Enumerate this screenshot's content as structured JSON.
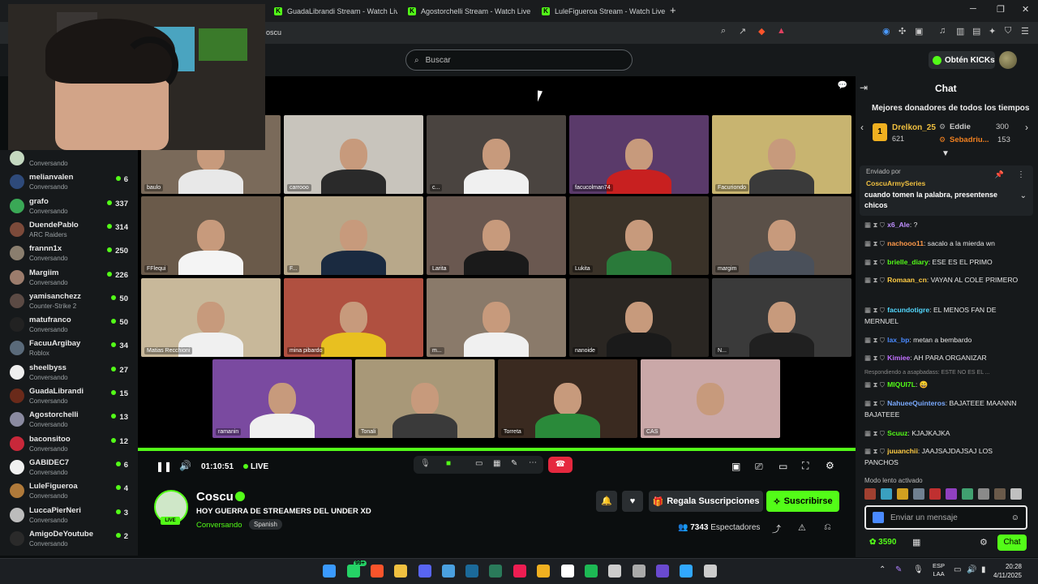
{
  "browser": {
    "tabs": [
      {
        "label": "GuadaLibrandi Stream - Watch Live o"
      },
      {
        "label": "Agostorchelli Stream - Watch Live on"
      },
      {
        "label": "LuleFigueroa Stream - Watch Live on"
      }
    ],
    "new_tab": "+",
    "url": "oscu"
  },
  "header": {
    "search_placeholder": "Buscar",
    "kicks_button": "Obtén KICKs"
  },
  "sidebar": {
    "items": [
      {
        "name": "",
        "category": "Conversando",
        "viewers": "",
        "color": "#c3d8c0"
      },
      {
        "name": "melianvalen",
        "category": "Conversando",
        "viewers": "6",
        "color": "#2e4a7a"
      },
      {
        "name": "grafo",
        "category": "Conversando",
        "viewers": "337",
        "color": "#3aa856"
      },
      {
        "name": "DuendePablo",
        "category": "ARC Raiders",
        "viewers": "314",
        "color": "#7c4a3a"
      },
      {
        "name": "frannn1x",
        "category": "Conversando",
        "viewers": "250",
        "color": "#8a7e6e"
      },
      {
        "name": "Margiim",
        "category": "Conversando",
        "viewers": "226",
        "color": "#9c7c6c"
      },
      {
        "name": "yamisanchezz",
        "category": "Counter-Strike 2",
        "viewers": "50",
        "color": "#5b4a44"
      },
      {
        "name": "matufranco",
        "category": "Conversando",
        "viewers": "50",
        "color": "#222"
      },
      {
        "name": "FacuuArgibay",
        "category": "Roblox",
        "viewers": "34",
        "color": "#5a6a7a"
      },
      {
        "name": "sheelbyss",
        "category": "Conversando",
        "viewers": "27",
        "color": "#eee"
      },
      {
        "name": "GuadaLibrandi",
        "category": "Conversando",
        "viewers": "15",
        "color": "#6a2a1a"
      },
      {
        "name": "Agostorchelli",
        "category": "Conversando",
        "viewers": "13",
        "color": "#8a8aa0"
      },
      {
        "name": "baconsitoo",
        "category": "Conversando",
        "viewers": "12",
        "color": "#c8283a"
      },
      {
        "name": "GABIDEC7",
        "category": "Conversando",
        "viewers": "6",
        "color": "#f0f0f0"
      },
      {
        "name": "LuleFigueroa",
        "category": "Conversando",
        "viewers": "4",
        "color": "#b07a3a"
      },
      {
        "name": "LuccaPierNeri",
        "category": "Conversando",
        "viewers": "3",
        "color": "#bcbcbc"
      },
      {
        "name": "AmigoDeYoutube",
        "category": "Conversando",
        "viewers": "2",
        "color": "#2a2a2a"
      }
    ]
  },
  "player": {
    "tiles": [
      {
        "label": "baulo",
        "bg": "#7a6a5a",
        "shirt": "#e8e8e8"
      },
      {
        "label": "carrooo",
        "bg": "#c8c4bc",
        "shirt": "#2a2a2a"
      },
      {
        "label": "c...",
        "bg": "#4a4440",
        "shirt": "#f0f0f0"
      },
      {
        "label": "facucolman74",
        "bg": "#5a3a6a",
        "shirt": "#c82020"
      },
      {
        "label": "Facuriondo",
        "bg": "#c8b470",
        "shirt": "#3a3a3a"
      },
      {
        "label": "FFlequi",
        "bg": "#6a5a4a",
        "shirt": "#f4f4f4"
      },
      {
        "label": "F...",
        "bg": "#b8a88a",
        "shirt": "#1a2a40"
      },
      {
        "label": "Larita",
        "bg": "#6a5850",
        "shirt": "#1a1a1a"
      },
      {
        "label": "Lukita",
        "bg": "#3a3228",
        "shirt": "#2a7a3a"
      },
      {
        "label": "margim",
        "bg": "#5a5048",
        "shirt": "#4a505a"
      },
      {
        "label": "Matias Recchioni",
        "bg": "#c8b89a",
        "shirt": "#f0f0f0"
      },
      {
        "label": "mina pibardo",
        "bg": "#b05040",
        "shirt": "#e8c020"
      },
      {
        "label": "m...",
        "bg": "#8a7a6a",
        "shirt": "#f0f0f0"
      },
      {
        "label": "nanoide",
        "bg": "#2a2622",
        "shirt": "#1a1a1a"
      },
      {
        "label": "N...",
        "bg": "#3a3a3a",
        "shirt": "#202020"
      },
      {
        "label": "ramanin",
        "bg": "#7a4aa0",
        "shirt": "#f0f0f0"
      },
      {
        "label": "Tonali",
        "bg": "#a89878",
        "shirt": "#3a3a3a"
      },
      {
        "label": "Torreta",
        "bg": "#3a2a20",
        "shirt": "#2a8a3a"
      },
      {
        "label": "CAS",
        "bg": "#caa8a8",
        "shirt": "#caa8a8"
      }
    ],
    "time": "01:10:51",
    "live": "LIVE"
  },
  "channel": {
    "name": "Coscu",
    "title": "HOY GUERRA DE STREAMERS DEL UNDER XD",
    "category": "Conversando",
    "language": "Spanish",
    "live_badge": "LIVE",
    "gift_label": "Regala Suscripciones",
    "subscribe_label": "Suscribirse",
    "viewers": "7343",
    "viewers_label": "Espectadores"
  },
  "chat": {
    "title": "Chat",
    "donors_title": "Mejores donadores de todos los tiempos",
    "donors": [
      {
        "rank": "1",
        "name": "Drelkon_25",
        "amount": "621"
      },
      {
        "name": "Eddie",
        "amount": "300"
      },
      {
        "name": "Sebadriu...",
        "amount": "153"
      }
    ],
    "pinned_by_label": "Enviado por",
    "pinned_user": "CoscuArmySeries",
    "pinned_text": "cuando tomen la palabra, presentense chicos",
    "messages": [
      {
        "user": "x6_Ale",
        "color": "#c090ff",
        "text": "?"
      },
      {
        "user": "nachooo11",
        "color": "#ff9a4a",
        "text": "sacalo a la mierda wn"
      },
      {
        "user": "brielle_diary",
        "color": "#53fc18",
        "text": "ESE ES EL PRIMO"
      },
      {
        "user": "Romaan_cn",
        "color": "#ffcc44",
        "text": "VAYAN AL COLE PRIMERO"
      },
      {
        "user": "facundotigre",
        "color": "#53d8ff",
        "text": "EL MENOS FAN DE MERNUEL"
      },
      {
        "user": "lax_bp",
        "color": "#4a8aff",
        "text": "metan a bembardo"
      },
      {
        "user": "Kimiee",
        "color": "#c070ff",
        "text": "AH PARA ORGANIZAR"
      },
      {
        "user": "MIQUI7L",
        "color": "#53fc18",
        "text": "😄",
        "reply": "Respondiendo a asapbadass: ESTE NO ES EL ..."
      },
      {
        "user": "NahueeQuinteros",
        "color": "#7aaaff",
        "text": "BAJATEEE MAANNN BAJATEEE"
      },
      {
        "user": "Scuuz",
        "color": "#53fc18",
        "text": "KJAJKAJKA"
      },
      {
        "user": "juuanchii",
        "color": "#ffcc44",
        "text": "JAAJSAJDAJSAJ LOS PANCHOS"
      }
    ],
    "slow_mode": "Modo lento activado",
    "input_placeholder": "Enviar un mensaje",
    "points": "3590",
    "send_label": "Chat"
  },
  "taskbar": {
    "notification_badge": "99+",
    "lang_line1": "ESP",
    "lang_line2": "LAA",
    "time": "20:28",
    "date": "4/11/2025"
  }
}
